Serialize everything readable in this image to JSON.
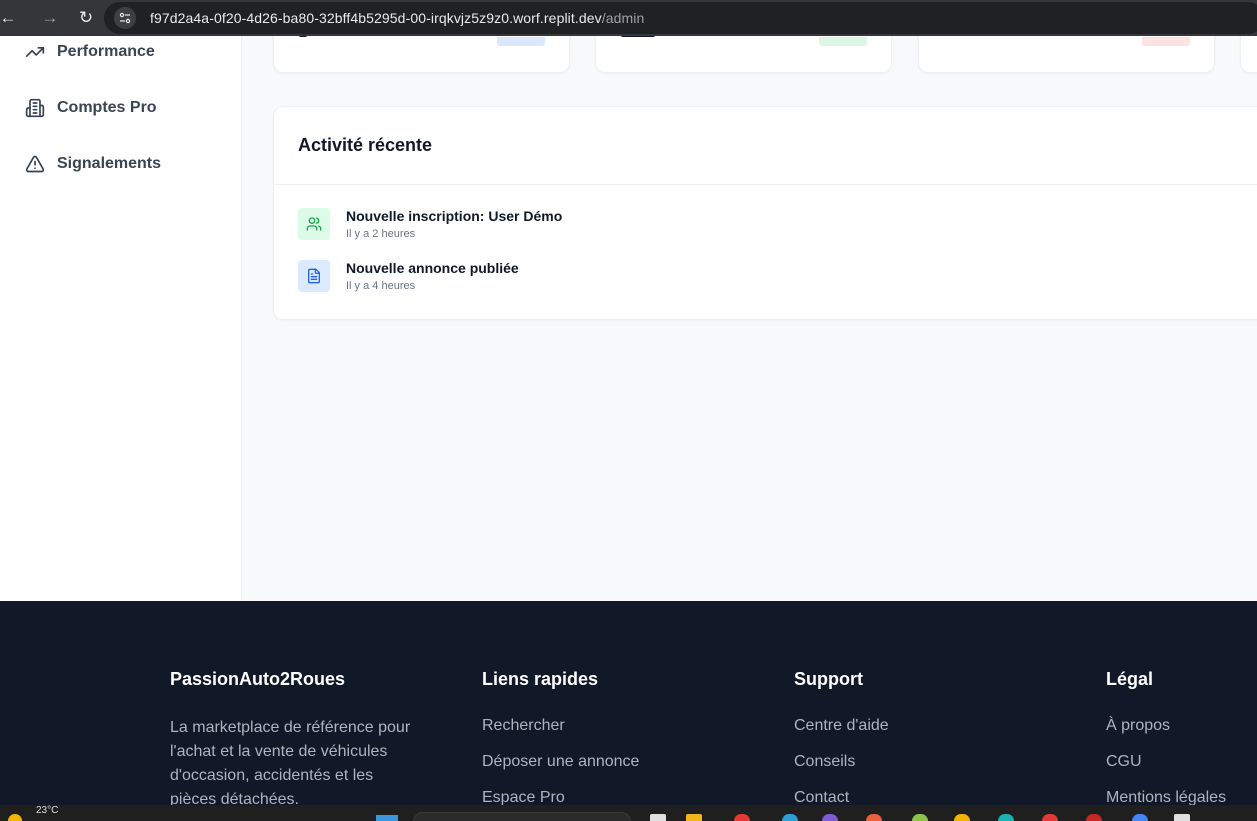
{
  "browser": {
    "back_icon": "arrow-left-icon",
    "forward_icon": "arrow-right-icon",
    "reload_icon": "reload-icon",
    "url_host": "f97d2a4a-0f20-4d26-ba80-32bff4b5295d-00-irqkvjz5z9z0.worf.replit.dev",
    "url_path": "/admin"
  },
  "sidebar": {
    "items": [
      {
        "label": "Performance",
        "icon": "trending-up-icon"
      },
      {
        "label": "Comptes Pro",
        "icon": "building-icon"
      },
      {
        "label": "Signalements",
        "icon": "warning-triangle-icon"
      }
    ]
  },
  "stat_cards": [
    {
      "accent": "#dbe7fd"
    },
    {
      "accent": "#dcf7e3"
    },
    {
      "accent": "#fde2e2"
    }
  ],
  "activity": {
    "title": "Activité récente",
    "items": [
      {
        "title": "Nouvelle inscription: User Démo",
        "time": "Il y a 2 heures",
        "icon": "users-icon",
        "color": "#16a34a",
        "bg": "#dcfce7"
      },
      {
        "title": "Nouvelle annonce publiée",
        "time": "Il y a 4 heures",
        "icon": "document-icon",
        "color": "#2563eb",
        "bg": "#dbeafe"
      }
    ]
  },
  "footer": {
    "brand": "PassionAuto2Roues",
    "description": "La marketplace de référence pour l'achat et la vente de véhicules d'occasion, accidentés et les pièces détachées.",
    "quick_links": {
      "title": "Liens rapides",
      "links": [
        "Rechercher",
        "Déposer une annonce",
        "Espace Pro"
      ]
    },
    "support": {
      "title": "Support",
      "links": [
        "Centre d'aide",
        "Conseils",
        "Contact"
      ]
    },
    "legal": {
      "title": "Légal",
      "links": [
        "À propos",
        "CGU",
        "Mentions légales"
      ]
    }
  },
  "taskbar": {
    "temperature": "23°C"
  }
}
